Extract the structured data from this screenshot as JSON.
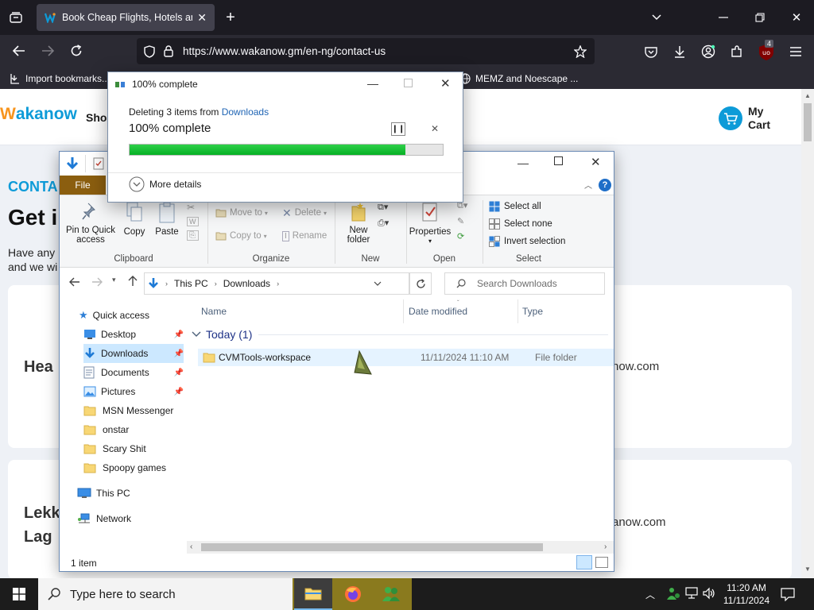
{
  "browser": {
    "tab_title": "Book Cheap Flights, Hotels and",
    "url": "https://www.wakanow.gm/en-ng/contact-us",
    "bookmarks": [
      {
        "label": "Import bookmarks..."
      },
      {
        "label": "MEMZ and Noescape ..."
      }
    ],
    "extension_badge": "4"
  },
  "website": {
    "logo_text": "akanow",
    "logo_prefix": "W",
    "nav_label": "Shop",
    "cart_line1": "My",
    "cart_line2": "Cart",
    "section_tag": "CONTA",
    "heading": "Get i",
    "body_line1": "Have any",
    "body_line2": "and we wi",
    "card1_title": "Hea",
    "card1_email": "now.com",
    "card2_title1": "Lekk",
    "card2_title2": "Lag",
    "card2_email": "anow.com"
  },
  "progress_dialog": {
    "title": "100% complete",
    "description_prefix": "Deleting 3 items from ",
    "description_link": "Downloads",
    "status": "100% complete",
    "progress_percent": 88,
    "more_details": "More details"
  },
  "explorer": {
    "ribbon_file_tab": "File",
    "clipboard": {
      "pin": "Pin to Quick access",
      "copy": "Copy",
      "paste": "Paste",
      "label": "Clipboard"
    },
    "organize": {
      "move_to": "Move to",
      "copy_to": "Copy to",
      "delete": "Delete",
      "rename": "Rename",
      "label": "Organize"
    },
    "new": {
      "new_folder": "New folder",
      "label": "New"
    },
    "open": {
      "properties": "Properties",
      "label": "Open"
    },
    "select": {
      "select_all": "Select all",
      "select_none": "Select none",
      "invert": "Invert selection",
      "label": "Select"
    },
    "breadcrumb": [
      "This PC",
      "Downloads"
    ],
    "search_placeholder": "Search Downloads",
    "nav": {
      "quick_access": "Quick access",
      "items": [
        {
          "label": "Desktop",
          "icon": "desktop-icon",
          "pinned": true
        },
        {
          "label": "Downloads",
          "icon": "downloads-icon",
          "pinned": true,
          "selected": true
        },
        {
          "label": "Documents",
          "icon": "documents-icon",
          "pinned": true
        },
        {
          "label": "Pictures",
          "icon": "pictures-icon",
          "pinned": true
        },
        {
          "label": "MSN Messenger",
          "icon": "folder-icon"
        },
        {
          "label": "onstar",
          "icon": "folder-icon"
        },
        {
          "label": "Scary Shit",
          "icon": "folder-icon"
        },
        {
          "label": "Spoopy games",
          "icon": "folder-icon"
        }
      ],
      "this_pc": "This PC",
      "network": "Network"
    },
    "columns": {
      "name": "Name",
      "date_modified": "Date modified",
      "type": "Type"
    },
    "group_header": "Today (1)",
    "files": [
      {
        "name": "CVMTools-workspace",
        "date": "11/11/2024 11:10 AM",
        "type": "File folder"
      }
    ],
    "status_text": "1 item"
  },
  "taskbar": {
    "search_placeholder": "Type here to search",
    "time": "11:20 AM",
    "date": "11/11/2024"
  },
  "colors": {
    "accent": "#0078d4",
    "progress_green": "#06b025",
    "file_tab": "#8b5e0f",
    "wakanow_blue": "#0d9bd8",
    "wakanow_orange": "#f7941d"
  }
}
